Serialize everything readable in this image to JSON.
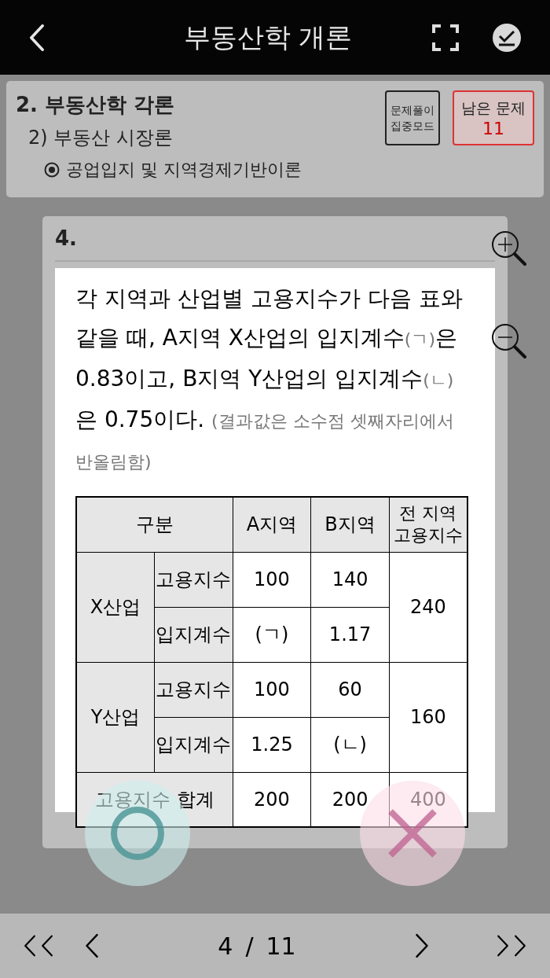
{
  "header": {
    "title": "부동산학 개론"
  },
  "breadcrumb": {
    "chapter": "2. 부동산학 각론",
    "section": "2) 부동산 시장론",
    "topic": "공업입지 및 지역경제기반이론",
    "focus_button": "문제풀이 집중모드",
    "remaining": {
      "label": "남은 문제",
      "count": "11"
    }
  },
  "question": {
    "number": "4.",
    "segments": [
      {
        "kind": "main",
        "text": "각 지역과 산업별 고용지수가 다음 표와 같을 때, A지역 X산업의 입지계수"
      },
      {
        "kind": "note",
        "text": "(ㄱ)"
      },
      {
        "kind": "main",
        "text": "은 0.83이고, B지역 Y산업의 입지계수"
      },
      {
        "kind": "note",
        "text": "(ㄴ)"
      },
      {
        "kind": "main",
        "text": "은 0.75이다. "
      },
      {
        "kind": "note",
        "text": "(결과값은 소수점 셋째자리에서 반올림함)"
      }
    ],
    "table": {
      "header": [
        "구분",
        "A지역",
        "B지역",
        "전 지역 고용지수"
      ],
      "groups": [
        {
          "label": "X산업",
          "total": "240",
          "rows": [
            {
              "label": "고용지수",
              "a": "100",
              "b": "140"
            },
            {
              "label": "입지계수",
              "a": "(ㄱ)",
              "b": "1.17"
            }
          ]
        },
        {
          "label": "Y산업",
          "total": "160",
          "rows": [
            {
              "label": "고용지수",
              "a": "100",
              "b": "60"
            },
            {
              "label": "입지계수",
              "a": "1.25",
              "b": "(ㄴ)"
            }
          ]
        }
      ],
      "footer": {
        "label": "고용지수 합계",
        "a": "200",
        "b": "200",
        "total": "400"
      }
    }
  },
  "pager": {
    "current": "4",
    "separator": "/",
    "total": "11"
  }
}
